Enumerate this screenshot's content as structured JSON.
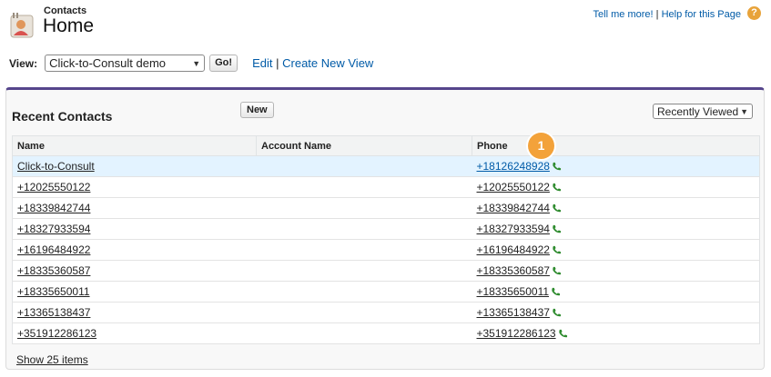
{
  "header": {
    "object_label": "Contacts",
    "title": "Home",
    "tell_me_more": "Tell me more!",
    "separator": "|",
    "help_page": "Help for this Page",
    "help_glyph": "?"
  },
  "view": {
    "label": "View:",
    "selected": "Click-to-Consult demo",
    "go_label": "Go!",
    "edit_label": "Edit",
    "separator": "|",
    "create_label": "Create New View"
  },
  "panel": {
    "title": "Recent Contacts",
    "new_label": "New",
    "filter_selected": "Recently Viewed",
    "columns": [
      "Name",
      "Account Name",
      "Phone"
    ],
    "badge": "1",
    "rows": [
      {
        "name": "Click-to-Consult",
        "account": "",
        "phone": "+18126248928"
      },
      {
        "name": "+12025550122",
        "account": "",
        "phone": "+12025550122"
      },
      {
        "name": "+18339842744",
        "account": "",
        "phone": "+18339842744"
      },
      {
        "name": "+18327933594",
        "account": "",
        "phone": "+18327933594"
      },
      {
        "name": "+16196484922",
        "account": "",
        "phone": "+16196484922"
      },
      {
        "name": "+18335360587",
        "account": "",
        "phone": "+18335360587"
      },
      {
        "name": "+18335650011",
        "account": "",
        "phone": "+18335650011"
      },
      {
        "name": "+13365138437",
        "account": "",
        "phone": "+13365138437"
      },
      {
        "name": "+351912286123",
        "account": "",
        "phone": "+351912286123"
      }
    ],
    "show_more": "Show 25 items"
  },
  "colors": {
    "accent_border": "#56458c",
    "link": "#015ba7",
    "badge": "#f3a23a",
    "phone_icon": "#2e8b2e",
    "highlight_row": "#e3f3ff"
  }
}
